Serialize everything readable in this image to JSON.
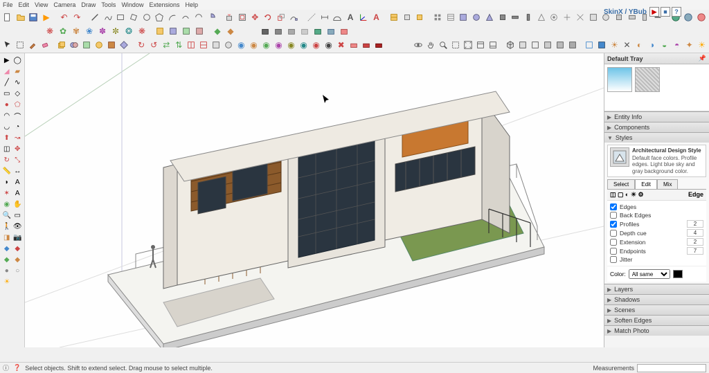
{
  "menu": {
    "items": [
      "File",
      "Edit",
      "View",
      "Camera",
      "Draw",
      "Tools",
      "Window",
      "Extensions",
      "Help"
    ]
  },
  "brand": "SkinX / YBub",
  "tray": {
    "title": "Default Tray",
    "panels": {
      "entity": "Entity Info",
      "components": "Components",
      "styles": "Styles",
      "layers": "Layers",
      "shadows": "Shadows",
      "scenes": "Scenes",
      "soften": "Soften Edges",
      "match": "Match Photo"
    },
    "style": {
      "name": "Architectural Design Style",
      "desc": "Default face colors. Profile edges. Light blue sky and gray background color."
    },
    "tabs": {
      "select": "Select",
      "edit": "Edit",
      "mix": "Mix"
    },
    "edge_label": "Edge",
    "opts": {
      "edges": "Edges",
      "back": "Back Edges",
      "profiles": "Profiles",
      "profiles_v": "2",
      "depth": "Depth cue",
      "depth_v": "4",
      "ext": "Extension",
      "ext_v": "2",
      "end": "Endpoints",
      "end_v": "7",
      "jitter": "Jitter"
    },
    "color_label": "Color:",
    "color_mode": "All same"
  },
  "status": {
    "hint": "Select objects. Shift to extend select. Drag mouse to select multiple.",
    "meas_label": "Measurements"
  }
}
